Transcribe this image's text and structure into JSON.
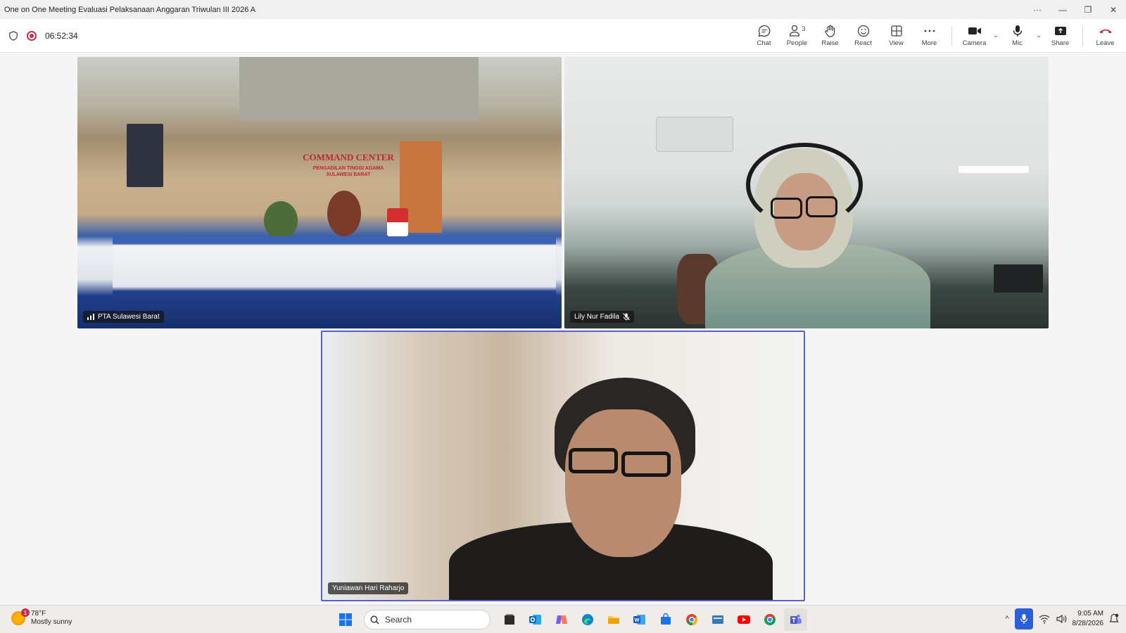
{
  "window": {
    "title": "One on One Meeting Evaluasi Pelaksanaan Anggaran Triwulan III 2026 A",
    "controls": [
      "···",
      "—",
      "❐",
      "✕"
    ]
  },
  "meeting": {
    "timer": "06:52:34",
    "people_count": "3",
    "toolbar": {
      "chat": "Chat",
      "people": "People",
      "raise": "Raise",
      "react": "React",
      "view": "View",
      "more": "More",
      "camera": "Camera",
      "mic": "Mic",
      "share": "Share",
      "leave": "Leave"
    },
    "colors": {
      "leave": "#c4314b",
      "active_speaker_border": "#5b5fc7",
      "record": "#c4314b"
    }
  },
  "participants": [
    {
      "name": "PTA Sulawesi Barat",
      "indicator": "signal-icon"
    },
    {
      "name": "Lily Nur Fadila",
      "indicator": "mic-off-icon"
    },
    {
      "name": "Yuniawan Hari Raharjo",
      "indicator": ""
    }
  ],
  "scene": {
    "sign_line1": "COMMAND CENTER",
    "sign_line2": "PENGADILAN TINGGI AGAMA",
    "sign_line3": "SULAWESI BARAT"
  },
  "taskbar": {
    "weather_temp": "78°F",
    "weather_desc": "Mostly sunny",
    "weather_badge": "1",
    "search_placeholder": "Search",
    "time": "9:05 AM",
    "date": "8/28/2026",
    "apps": [
      "windows-start-icon",
      "file-manager-icon",
      "outlook-icon",
      "copilot-icon",
      "edge-icon",
      "file-explorer-icon",
      "word-icon",
      "store-icon",
      "chrome-icon",
      "folder-app-icon",
      "youtube-icon",
      "chrome-profile-icon",
      "teams-icon"
    ]
  }
}
